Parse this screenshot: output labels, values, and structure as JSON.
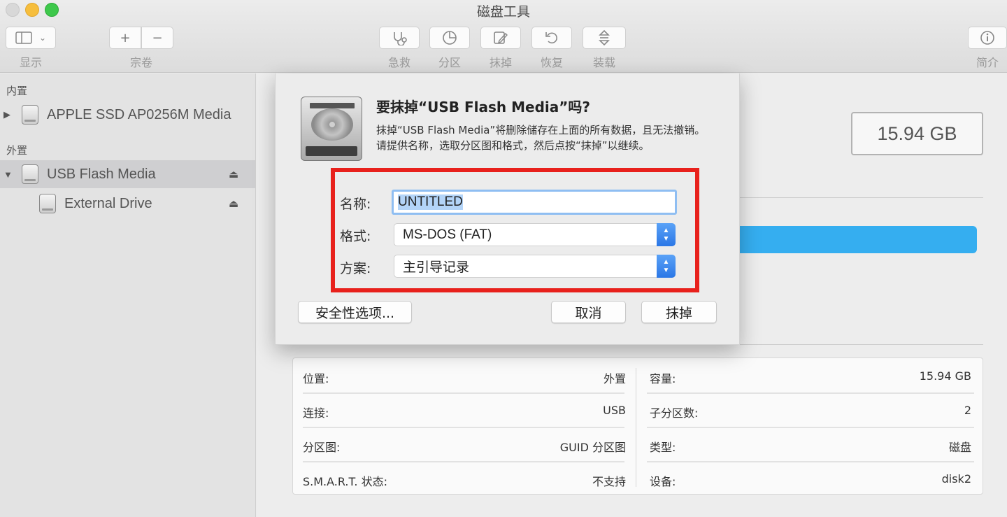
{
  "window": {
    "title": "磁盘工具"
  },
  "toolbar": {
    "view_label": "显示",
    "volume_label": "宗卷",
    "add_symbol": "+",
    "remove_symbol": "−",
    "firstaid_label": "急救",
    "partition_label": "分区",
    "erase_label": "抹掉",
    "restore_label": "恢复",
    "mount_label": "装载",
    "info_label": "简介"
  },
  "sidebar": {
    "internal_title": "内置",
    "external_title": "外置",
    "items": [
      {
        "label": "APPLE SSD AP0256M Media"
      },
      {
        "label": "USB Flash Media"
      },
      {
        "label": "External Drive"
      }
    ]
  },
  "main": {
    "capacity": "15.94 GB"
  },
  "dialog": {
    "title": "要抹掉“USB Flash Media”吗?",
    "message": "抹掉“USB Flash Media”将删除储存在上面的所有数据，且无法撤销。请提供名称，选取分区图和格式，然后点按“抹掉”以继续。",
    "name_label": "名称:",
    "name_value": "UNTITLED",
    "format_label": "格式:",
    "format_value": "MS-DOS (FAT)",
    "scheme_label": "方案:",
    "scheme_value": "主引导记录",
    "security_button": "安全性选项...",
    "cancel_button": "取消",
    "erase_button": "抹掉"
  },
  "info": {
    "rows": [
      {
        "l_label": "位置:",
        "l_value": "外置",
        "r_label": "容量:",
        "r_value": "15.94 GB"
      },
      {
        "l_label": "连接:",
        "l_value": "USB",
        "r_label": "子分区数:",
        "r_value": "2"
      },
      {
        "l_label": "分区图:",
        "l_value": "GUID 分区图",
        "r_label": "类型:",
        "r_value": "磁盘"
      },
      {
        "l_label": "S.M.A.R.T. 状态:",
        "l_value": "不支持",
        "r_label": "设备:",
        "r_value": "disk2"
      }
    ]
  },
  "colors": {
    "accent": "#35aef0",
    "highlight_box": "#e8211c",
    "select_stepper": "#2b77e6"
  }
}
